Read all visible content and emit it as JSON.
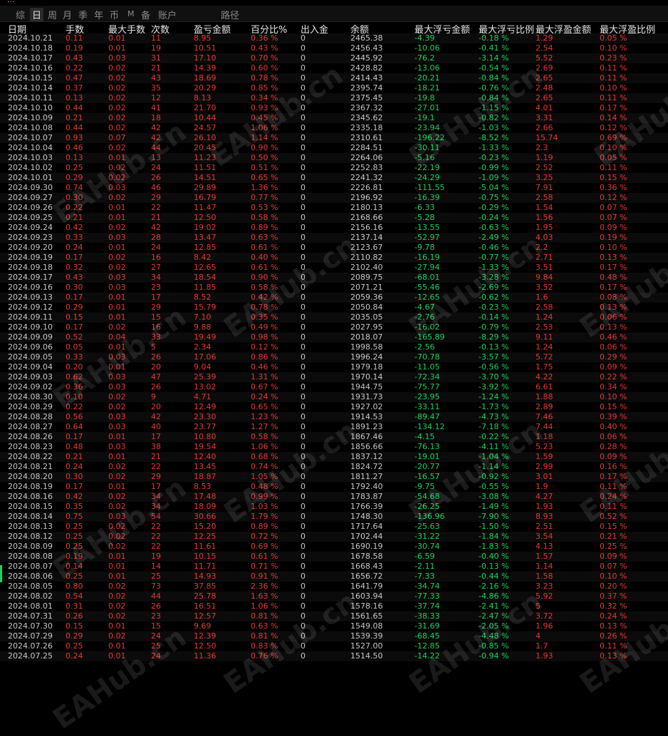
{
  "top_strip": "...",
  "tabs": [
    {
      "label": "综",
      "active": false
    },
    {
      "label": "日",
      "active": true
    },
    {
      "label": "周",
      "active": false
    },
    {
      "label": "月",
      "active": false
    },
    {
      "label": "季",
      "active": false
    },
    {
      "label": "年",
      "active": false
    },
    {
      "label": "币",
      "active": false
    },
    {
      "label": "M",
      "active": false
    },
    {
      "label": "备",
      "active": false
    },
    {
      "label": "账户",
      "active": false
    },
    {
      "label": "路径",
      "active": false
    }
  ],
  "columns": [
    "日期",
    "手数",
    "最大手数",
    "次数",
    "盈亏金额",
    "百分比%",
    "出入金",
    "余额",
    "最大浮亏金额",
    "最大浮亏比例",
    "最大浮盈金额",
    "最大浮盈比例"
  ],
  "watermark": "EAHub.cn",
  "rows": [
    [
      "2024.10.21",
      "0.11",
      "0.01",
      "11",
      "8.95",
      "0.36 %",
      "0",
      "2465.38",
      "-4.39",
      "-0.18 %",
      "1.29",
      "0.05 %"
    ],
    [
      "2024.10.18",
      "0.19",
      "0.01",
      "19",
      "10.51",
      "0.43 %",
      "0",
      "2456.43",
      "-10.06",
      "-0.41 %",
      "2.54",
      "0.10 %"
    ],
    [
      "2024.10.17",
      "0.43",
      "0.03",
      "31",
      "17.10",
      "0.70 %",
      "0",
      "2445.92",
      "-76.2",
      "-3.14 %",
      "5.52",
      "0.23 %"
    ],
    [
      "2024.10.16",
      "0.22",
      "0.02",
      "21",
      "14.39",
      "0.60 %",
      "0",
      "2428.82",
      "-13.06",
      "-0.54 %",
      "2.69",
      "0.11 %"
    ],
    [
      "2024.10.15",
      "0.47",
      "0.02",
      "43",
      "18.69",
      "0.78 %",
      "0",
      "2414.43",
      "-20.21",
      "-0.84 %",
      "2.65",
      "0.11 %"
    ],
    [
      "2024.10.14",
      "0.37",
      "0.02",
      "35",
      "20.29",
      "0.85 %",
      "0",
      "2395.74",
      "-18.21",
      "-0.76 %",
      "2.48",
      "0.10 %"
    ],
    [
      "2024.10.11",
      "0.13",
      "0.02",
      "12",
      "8.13",
      "0.34 %",
      "0",
      "2375.45",
      "-19.8",
      "-0.84 %",
      "2.65",
      "0.11 %"
    ],
    [
      "2024.10.10",
      "0.44",
      "0.02",
      "41",
      "21.70",
      "0.93 %",
      "0",
      "2367.32",
      "-27.01",
      "-1.15 %",
      "4.01",
      "0.17 %"
    ],
    [
      "2024.10.09",
      "0.21",
      "0.02",
      "18",
      "10.44",
      "0.45 %",
      "0",
      "2345.62",
      "-19.1",
      "-0.82 %",
      "3.31",
      "0.14 %"
    ],
    [
      "2024.10.08",
      "0.44",
      "0.02",
      "42",
      "24.57",
      "1.06 %",
      "0",
      "2335.18",
      "-23.94",
      "-1.03 %",
      "2.66",
      "0.12 %"
    ],
    [
      "2024.10.07",
      "0.93",
      "0.07",
      "42",
      "26.10",
      "1.14 %",
      "0",
      "2310.61",
      "-196.22",
      "-8.52 %",
      "15.74",
      "0.69 %"
    ],
    [
      "2024.10.04",
      "0.46",
      "0.02",
      "44",
      "20.45",
      "0.90 %",
      "0",
      "2284.51",
      "-30.11",
      "-1.33 %",
      "2.3",
      "0.10 %"
    ],
    [
      "2024.10.03",
      "0.13",
      "0.01",
      "13",
      "11.23",
      "0.50 %",
      "0",
      "2264.06",
      "-5.16",
      "-0.23 %",
      "1.19",
      "0.05 %"
    ],
    [
      "2024.10.02",
      "0.25",
      "0.02",
      "24",
      "11.51",
      "0.51 %",
      "0",
      "2252.83",
      "-22.19",
      "-0.99 %",
      "2.52",
      "0.11 %"
    ],
    [
      "2024.10.01",
      "0.29",
      "0.02",
      "26",
      "14.51",
      "0.65 %",
      "0",
      "2241.32",
      "-24.29",
      "-1.09 %",
      "3.25",
      "0.15 %"
    ],
    [
      "2024.09.30",
      "0.74",
      "0.03",
      "46",
      "29.89",
      "1.36 %",
      "0",
      "2226.81",
      "-111.55",
      "-5.04 %",
      "7.91",
      "0.36 %"
    ],
    [
      "2024.09.27",
      "0.30",
      "0.02",
      "29",
      "16.79",
      "0.77 %",
      "0",
      "2196.92",
      "-16.39",
      "-0.75 %",
      "2.58",
      "0.12 %"
    ],
    [
      "2024.09.26",
      "0.22",
      "0.01",
      "22",
      "11.47",
      "0.53 %",
      "0",
      "2180.13",
      "-6.33",
      "-0.29 %",
      "1.54",
      "0.07 %"
    ],
    [
      "2024.09.25",
      "0.21",
      "0.01",
      "21",
      "12.50",
      "0.58 %",
      "0",
      "2168.66",
      "-5.28",
      "-0.24 %",
      "1.56",
      "0.07 %"
    ],
    [
      "2024.09.24",
      "0.42",
      "0.02",
      "42",
      "19.02",
      "0.89 %",
      "0",
      "2156.16",
      "-13.55",
      "-0.63 %",
      "1.95",
      "0.09 %"
    ],
    [
      "2024.09.23",
      "0.33",
      "0.03",
      "28",
      "13.47",
      "0.63 %",
      "0",
      "2137.14",
      "-52.97",
      "-2.49 %",
      "4.03",
      "0.19 %"
    ],
    [
      "2024.09.20",
      "0.24",
      "0.01",
      "24",
      "12.85",
      "0.61 %",
      "0",
      "2123.67",
      "-9.78",
      "-0.46 %",
      "2.2",
      "0.10 %"
    ],
    [
      "2024.09.19",
      "0.17",
      "0.02",
      "16",
      "8.42",
      "0.40 %",
      "0",
      "2110.82",
      "-16.19",
      "-0.77 %",
      "2.71",
      "0.13 %"
    ],
    [
      "2024.09.18",
      "0.32",
      "0.02",
      "27",
      "12.65",
      "0.61 %",
      "0",
      "2102.40",
      "-27.94",
      "-1.33 %",
      "3.51",
      "0.17 %"
    ],
    [
      "2024.09.17",
      "0.43",
      "0.03",
      "34",
      "18.54",
      "0.90 %",
      "0",
      "2089.75",
      "-68.01",
      "-3.28 %",
      "9.84",
      "0.48 %"
    ],
    [
      "2024.09.16",
      "0.30",
      "0.03",
      "23",
      "11.85",
      "0.58 %",
      "0",
      "2071.21",
      "-55.46",
      "-2.69 %",
      "3.52",
      "0.17 %"
    ],
    [
      "2024.09.13",
      "0.17",
      "0.01",
      "17",
      "8.52",
      "0.42 %",
      "0",
      "2059.36",
      "-12.65",
      "-0.62 %",
      "1.6",
      "0.08 %"
    ],
    [
      "2024.09.12",
      "0.29",
      "0.01",
      "29",
      "15.79",
      "0.78 %",
      "0",
      "2050.84",
      "-4.67",
      "-0.23 %",
      "2.58",
      "0.13 %"
    ],
    [
      "2024.09.11",
      "0.15",
      "0.01",
      "15",
      "7.10",
      "0.35 %",
      "0",
      "2035.05",
      "-2.76",
      "-0.14 %",
      "1.24",
      "0.06 %"
    ],
    [
      "2024.09.10",
      "0.17",
      "0.02",
      "16",
      "9.88",
      "0.49 %",
      "0",
      "2027.95",
      "-16.02",
      "-0.79 %",
      "2.53",
      "0.13 %"
    ],
    [
      "2024.09.09",
      "0.52",
      "0.04",
      "33",
      "19.49",
      "0.98 %",
      "0",
      "2018.07",
      "-165.89",
      "-8.29 %",
      "9.11",
      "0.46 %"
    ],
    [
      "2024.09.06",
      "0.05",
      "0.01",
      "5",
      "2.34",
      "0.12 %",
      "0",
      "1998.58",
      "-2.56",
      "-0.13 %",
      "1.24",
      "0.06 %"
    ],
    [
      "2024.09.05",
      "0.33",
      "0.03",
      "26",
      "17.06",
      "0.86 %",
      "0",
      "1996.24",
      "-70.78",
      "-3.57 %",
      "5.72",
      "0.29 %"
    ],
    [
      "2024.09.04",
      "0.20",
      "0.01",
      "20",
      "9.04",
      "0.46 %",
      "0",
      "1979.18",
      "-11.05",
      "-0.56 %",
      "1.75",
      "0.09 %"
    ],
    [
      "2024.09.03",
      "0.62",
      "0.03",
      "47",
      "25.39",
      "1.31 %",
      "0",
      "1970.14",
      "-72.34",
      "-3.70 %",
      "4.22",
      "0.22 %"
    ],
    [
      "2024.09.02",
      "0.36",
      "0.03",
      "26",
      "13.02",
      "0.67 %",
      "0",
      "1944.75",
      "-75.77",
      "-3.92 %",
      "6.61",
      "0.34 %"
    ],
    [
      "2024.08.30",
      "0.10",
      "0.02",
      "9",
      "4.71",
      "0.24 %",
      "0",
      "1931.73",
      "-23.95",
      "-1.24 %",
      "1.88",
      "0.10 %"
    ],
    [
      "2024.08.29",
      "0.22",
      "0.02",
      "20",
      "12.49",
      "0.65 %",
      "0",
      "1927.02",
      "-33.11",
      "-1.73 %",
      "2.89",
      "0.15 %"
    ],
    [
      "2024.08.28",
      "0.56",
      "0.03",
      "42",
      "23.30",
      "1.23 %",
      "0",
      "1914.53",
      "-89.47",
      "-4.73 %",
      "7.46",
      "0.39 %"
    ],
    [
      "2024.08.27",
      "0.64",
      "0.03",
      "40",
      "23.77",
      "1.27 %",
      "0",
      "1891.23",
      "-134.12",
      "-7.18 %",
      "7.44",
      "0.40 %"
    ],
    [
      "2024.08.26",
      "0.17",
      "0.01",
      "17",
      "10.80",
      "0.58 %",
      "0",
      "1867.46",
      "-4.15",
      "-0.22 %",
      "1.18",
      "0.06 %"
    ],
    [
      "2024.08.23",
      "0.48",
      "0.03",
      "38",
      "19.54",
      "1.06 %",
      "0",
      "1856.66",
      "-76.13",
      "-4.11 %",
      "5.23",
      "0.28 %"
    ],
    [
      "2024.08.22",
      "0.21",
      "0.01",
      "21",
      "12.40",
      "0.68 %",
      "0",
      "1837.12",
      "-19.01",
      "-1.04 %",
      "1.59",
      "0.09 %"
    ],
    [
      "2024.08.21",
      "0.24",
      "0.02",
      "22",
      "13.45",
      "0.74 %",
      "0",
      "1824.72",
      "-20.77",
      "-1.14 %",
      "2.99",
      "0.16 %"
    ],
    [
      "2024.08.20",
      "0.30",
      "0.02",
      "29",
      "18.87",
      "1.05 %",
      "0",
      "1811.27",
      "-16.57",
      "-0.92 %",
      "3.01",
      "0.17 %"
    ],
    [
      "2024.08.19",
      "0.17",
      "0.01",
      "17",
      "8.53",
      "0.48 %",
      "0",
      "1792.40",
      "-9.75",
      "-0.55 %",
      "1.9",
      "0.11 %"
    ],
    [
      "2024.08.16",
      "0.42",
      "0.02",
      "34",
      "17.48",
      "0.99 %",
      "0",
      "1783.87",
      "-54.68",
      "-3.08 %",
      "4.27",
      "0.24 %"
    ],
    [
      "2024.08.15",
      "0.35",
      "0.02",
      "34",
      "18.09",
      "1.03 %",
      "0",
      "1766.39",
      "-26.25",
      "-1.49 %",
      "1.93",
      "0.11 %"
    ],
    [
      "2024.08.14",
      "0.75",
      "0.03",
      "54",
      "30.66",
      "1.79 %",
      "0",
      "1748.30",
      "-136.96",
      "-7.90 %",
      "8.93",
      "0.52 %"
    ],
    [
      "2024.08.13",
      "0.25",
      "0.02",
      "22",
      "15.20",
      "0.89 %",
      "0",
      "1717.64",
      "-25.63",
      "-1.50 %",
      "2.51",
      "0.15 %"
    ],
    [
      "2024.08.12",
      "0.25",
      "0.02",
      "22",
      "12.25",
      "0.72 %",
      "0",
      "1702.44",
      "-31.22",
      "-1.84 %",
      "3.54",
      "0.21 %"
    ],
    [
      "2024.08.09",
      "0.25",
      "0.02",
      "22",
      "11.61",
      "0.69 %",
      "0",
      "1690.19",
      "-30.74",
      "-1.83 %",
      "4.13",
      "0.25 %"
    ],
    [
      "2024.08.08",
      "0.19",
      "0.01",
      "19",
      "10.15",
      "0.61 %",
      "0",
      "1678.58",
      "-6.59",
      "-0.40 %",
      "1.57",
      "0.09 %"
    ],
    [
      "2024.08.07",
      "0.14",
      "0.01",
      "14",
      "11.71",
      "0.71 %",
      "0",
      "1668.43",
      "-2.11",
      "-0.13 %",
      "1.14",
      "0.07 %"
    ],
    [
      "2024.08.06",
      "0.25",
      "0.01",
      "25",
      "14.93",
      "0.91 %",
      "0",
      "1656.72",
      "-7.33",
      "-0.44 %",
      "1.58",
      "0.10 %"
    ],
    [
      "2024.08.05",
      "0.80",
      "0.02",
      "73",
      "37.85",
      "2.36 %",
      "0",
      "1641.79",
      "-34.74",
      "-2.16 %",
      "3.23",
      "0.20 %"
    ],
    [
      "2024.08.02",
      "0.54",
      "0.02",
      "44",
      "25.78",
      "1.63 %",
      "0",
      "1603.94",
      "-77.33",
      "-4.86 %",
      "5.92",
      "0.37 %"
    ],
    [
      "2024.08.01",
      "0.31",
      "0.02",
      "26",
      "16.51",
      "1.06 %",
      "0",
      "1578.16",
      "-37.74",
      "-2.41 %",
      "5",
      "0.32 %"
    ],
    [
      "2024.07.31",
      "0.26",
      "0.02",
      "23",
      "12.57",
      "0.81 %",
      "0",
      "1561.65",
      "-38.33",
      "-2.47 %",
      "3.72",
      "0.24 %"
    ],
    [
      "2024.07.30",
      "0.15",
      "0.01",
      "15",
      "9.69",
      "0.63 %",
      "0",
      "1549.08",
      "-31.69",
      "-2.05 %",
      "1.96",
      "0.13 %"
    ],
    [
      "2024.07.29",
      "0.29",
      "0.02",
      "24",
      "12.39",
      "0.81 %",
      "0",
      "1539.39",
      "-68.45",
      "-4.48 %",
      "4",
      "0.26 %"
    ],
    [
      "2024.07.26",
      "0.25",
      "0.01",
      "25",
      "12.50",
      "0.83 %",
      "0",
      "1527.00",
      "-12.85",
      "-0.85 %",
      "1.7",
      "0.11 %"
    ],
    [
      "2024.07.25",
      "0.24",
      "0.01",
      "24",
      "11.36",
      "0.76 %",
      "0",
      "1514.50",
      "-14.22",
      "-0.94 %",
      "1.93",
      "0.13 %"
    ]
  ]
}
